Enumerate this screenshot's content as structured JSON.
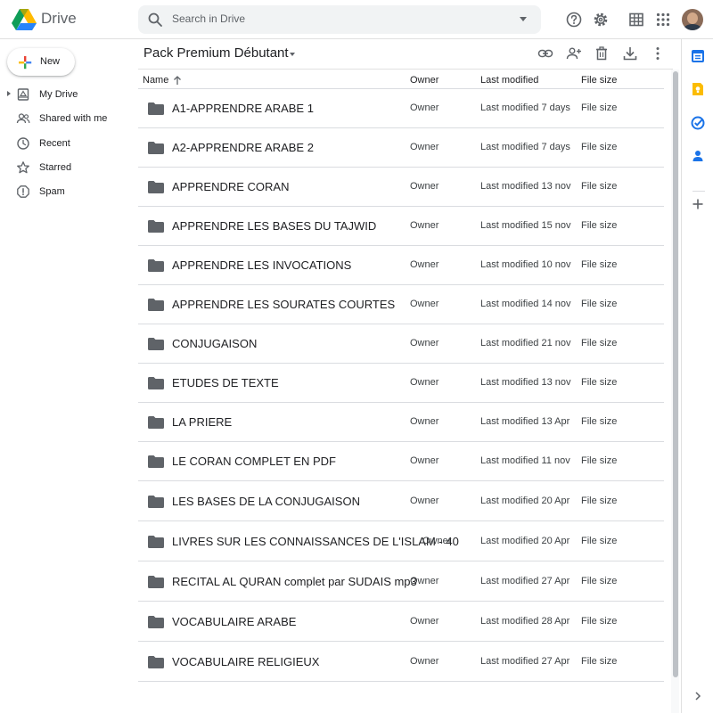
{
  "app": {
    "brand": "Drive"
  },
  "search": {
    "placeholder": "Search in Drive"
  },
  "sidebar": {
    "new_label": "New",
    "items": [
      {
        "label": "My Drive",
        "icon": "my-drive-icon"
      },
      {
        "label": "Shared with me",
        "icon": "shared-icon"
      },
      {
        "label": "Recent",
        "icon": "clock-icon"
      },
      {
        "label": "Starred",
        "icon": "star-icon"
      },
      {
        "label": "Spam",
        "icon": "spam-icon"
      }
    ]
  },
  "main": {
    "folder_title": "Pack Premium Débutant",
    "columns": {
      "name": "Name",
      "owner": "Owner",
      "modified": "Last modified",
      "size": "File size"
    },
    "rows": [
      {
        "name": "A1-APPRENDRE ARABE 1",
        "owner": "Owner",
        "modified": "Last modified 7 days",
        "size": "File size"
      },
      {
        "name": "A2-APPRENDRE ARABE 2",
        "owner": "Owner",
        "modified": "Last modified 7 days",
        "size": "File size"
      },
      {
        "name": "APPRENDRE CORAN",
        "owner": "Owner",
        "modified": "Last modified 13 nov",
        "size": "File size"
      },
      {
        "name": "APPRENDRE LES BASES DU TAJWID",
        "owner": "Owner",
        "modified": "Last modified 15 nov",
        "size": "File size"
      },
      {
        "name": "APPRENDRE LES INVOCATIONS",
        "owner": "Owner",
        "modified": "Last modified 10 nov",
        "size": "File size"
      },
      {
        "name": "APPRENDRE LES SOURATES COURTES",
        "owner": "Owner",
        "modified": "Last modified 14 nov",
        "size": "File size"
      },
      {
        "name": "CONJUGAISON",
        "owner": "Owner",
        "modified": "Last modified 21 nov",
        "size": "File size"
      },
      {
        "name": "ETUDES DE TEXTE",
        "owner": "Owner",
        "modified": "Last modified 13 nov",
        "size": "File size"
      },
      {
        "name": "LA PRIERE",
        "owner": "Owner",
        "modified": "Last modified 13 Apr",
        "size": "File size"
      },
      {
        "name": "LE CORAN COMPLET EN PDF",
        "owner": "Owner",
        "modified": "Last modified 11 nov",
        "size": "File size"
      },
      {
        "name": "LES BASES DE LA CONJUGAISON",
        "owner": "Owner",
        "modified": "Last modified 20 Apr",
        "size": "File size"
      },
      {
        "name": "LIVRES SUR LES CONNAISSANCES DE L'ISLAM - 40",
        "owner": "Owner",
        "modified": "Last modified 20 Apr",
        "size": "File size"
      },
      {
        "name": "RECITAL AL QURAN complet par SUDAIS mp3",
        "owner": "Owner",
        "modified": "Last modified 27 Apr",
        "size": "File size"
      },
      {
        "name": "VOCABULAIRE ARABE",
        "owner": "Owner",
        "modified": "Last modified 28 Apr",
        "size": "File size"
      },
      {
        "name": "VOCABULAIRE RELIGIEUX",
        "owner": "Owner",
        "modified": "Last modified 27 Apr",
        "size": "File size"
      }
    ]
  },
  "colors": {
    "icon_grey": "#5f6368",
    "folder": "#5f6368",
    "accent_blue": "#1a73e8"
  }
}
